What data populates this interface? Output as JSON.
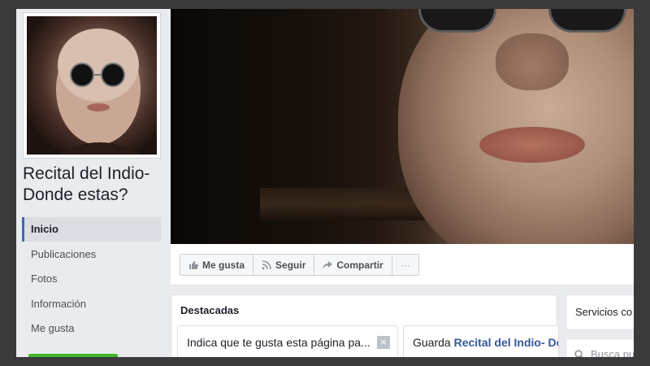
{
  "sidebar": {
    "page_name": "Recital del Indio- Donde estas?",
    "items": [
      {
        "label": "Inicio"
      },
      {
        "label": "Publicaciones"
      },
      {
        "label": "Fotos"
      },
      {
        "label": "Información"
      },
      {
        "label": "Me gusta"
      }
    ]
  },
  "actions": {
    "like": "Me gusta",
    "follow": "Seguir",
    "share": "Compartir",
    "more": "···"
  },
  "featured": {
    "title": "Destacadas",
    "card1_text": "Indica que te gusta esta página pa...",
    "card2_prefix": "Guarda ",
    "card2_name": "Recital del Indio- Do"
  },
  "right": {
    "services_label": "Servicios co",
    "search_placeholder": "Busca pu"
  },
  "colors": {
    "accent": "#4267b2",
    "link": "#365899",
    "green": "#42b72a"
  }
}
